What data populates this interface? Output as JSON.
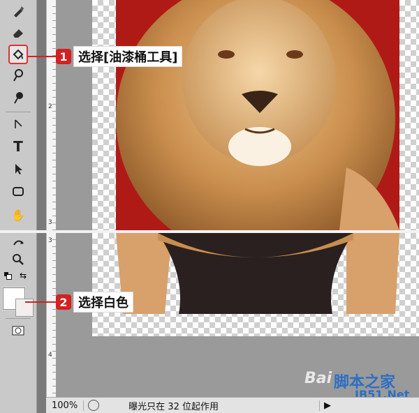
{
  "callouts": [
    {
      "number": "1",
      "label": "选择[油漆桶工具]"
    },
    {
      "number": "2",
      "label": "选择白色"
    }
  ],
  "ruler": {
    "top_marks": [
      "2",
      "3"
    ],
    "bottom_marks": [
      "3",
      "4"
    ]
  },
  "status": {
    "zoom": "100%",
    "message": "曝光只在 32 位起作用",
    "arrow_glyph": "▶"
  },
  "watermark": {
    "baidu": "Bai",
    "site_cn": "脚本之家",
    "site_url": "JB51.Net"
  },
  "icons": {
    "hand": "✋",
    "type": "T",
    "zoom": "🔍",
    "swap": "⇆"
  },
  "colors": {
    "accent_red": "#d32020",
    "image_background_red": "#b01a16",
    "mane": "#c98e4d",
    "jacket": "#d8a06a",
    "sweater": "#2a2020"
  }
}
